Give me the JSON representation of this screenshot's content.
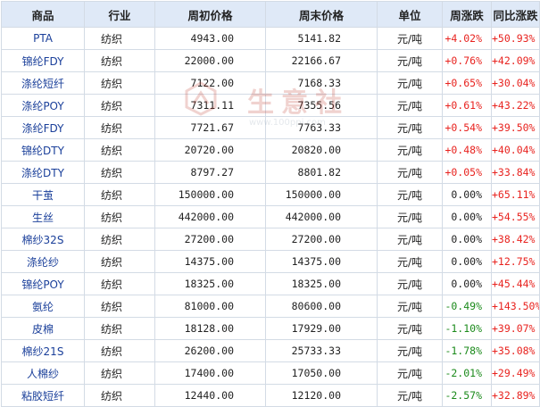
{
  "headers": {
    "name": "商品",
    "industry": "行业",
    "week_open": "周初价格",
    "week_close": "周末价格",
    "unit": "单位",
    "weekly_change": "周涨跌",
    "yoy_change": "同比涨跌"
  },
  "rows": [
    {
      "name": "PTA",
      "industry": "纺织",
      "open": "4943.00",
      "close": "5141.82",
      "unit": "元/吨",
      "week": "+4.02%",
      "yoy": "+50.93%",
      "week_dir": "up"
    },
    {
      "name": "锦纶FDY",
      "industry": "纺织",
      "open": "22000.00",
      "close": "22166.67",
      "unit": "元/吨",
      "week": "+0.76%",
      "yoy": "+42.09%",
      "week_dir": "up"
    },
    {
      "name": "涤纶短纤",
      "industry": "纺织",
      "open": "7122.00",
      "close": "7168.33",
      "unit": "元/吨",
      "week": "+0.65%",
      "yoy": "+30.04%",
      "week_dir": "up"
    },
    {
      "name": "涤纶POY",
      "industry": "纺织",
      "open": "7311.11",
      "close": "7355.56",
      "unit": "元/吨",
      "week": "+0.61%",
      "yoy": "+43.22%",
      "week_dir": "up"
    },
    {
      "name": "涤纶FDY",
      "industry": "纺织",
      "open": "7721.67",
      "close": "7763.33",
      "unit": "元/吨",
      "week": "+0.54%",
      "yoy": "+39.50%",
      "week_dir": "up"
    },
    {
      "name": "锦纶DTY",
      "industry": "纺织",
      "open": "20720.00",
      "close": "20820.00",
      "unit": "元/吨",
      "week": "+0.48%",
      "yoy": "+40.04%",
      "week_dir": "up"
    },
    {
      "name": "涤纶DTY",
      "industry": "纺织",
      "open": "8797.27",
      "close": "8801.82",
      "unit": "元/吨",
      "week": "+0.05%",
      "yoy": "+33.84%",
      "week_dir": "up"
    },
    {
      "name": "干茧",
      "industry": "纺织",
      "open": "150000.00",
      "close": "150000.00",
      "unit": "元/吨",
      "week": "0.00%",
      "yoy": "+65.11%",
      "week_dir": "flat"
    },
    {
      "name": "生丝",
      "industry": "纺织",
      "open": "442000.00",
      "close": "442000.00",
      "unit": "元/吨",
      "week": "0.00%",
      "yoy": "+54.55%",
      "week_dir": "flat"
    },
    {
      "name": "棉纱32S",
      "industry": "纺织",
      "open": "27200.00",
      "close": "27200.00",
      "unit": "元/吨",
      "week": "0.00%",
      "yoy": "+38.42%",
      "week_dir": "flat"
    },
    {
      "name": "涤纶纱",
      "industry": "纺织",
      "open": "14375.00",
      "close": "14375.00",
      "unit": "元/吨",
      "week": "0.00%",
      "yoy": "+12.75%",
      "week_dir": "flat"
    },
    {
      "name": "锦纶POY",
      "industry": "纺织",
      "open": "18325.00",
      "close": "18325.00",
      "unit": "元/吨",
      "week": "0.00%",
      "yoy": "+45.44%",
      "week_dir": "flat"
    },
    {
      "name": "氨纶",
      "industry": "纺织",
      "open": "81000.00",
      "close": "80600.00",
      "unit": "元/吨",
      "week": "-0.49%",
      "yoy": "+143.50%",
      "week_dir": "down"
    },
    {
      "name": "皮棉",
      "industry": "纺织",
      "open": "18128.00",
      "close": "17929.00",
      "unit": "元/吨",
      "week": "-1.10%",
      "yoy": "+39.07%",
      "week_dir": "down"
    },
    {
      "name": "棉纱21S",
      "industry": "纺织",
      "open": "26200.00",
      "close": "25733.33",
      "unit": "元/吨",
      "week": "-1.78%",
      "yoy": "+35.08%",
      "week_dir": "down"
    },
    {
      "name": "人棉纱",
      "industry": "纺织",
      "open": "17400.00",
      "close": "17050.00",
      "unit": "元/吨",
      "week": "-2.01%",
      "yoy": "+29.49%",
      "week_dir": "down"
    },
    {
      "name": "粘胶短纤",
      "industry": "纺织",
      "open": "12440.00",
      "close": "12120.00",
      "unit": "元/吨",
      "week": "-2.57%",
      "yoy": "+32.89%",
      "week_dir": "down"
    }
  ],
  "watermark": {
    "text": "生意社",
    "url": "www.100ppi.com"
  },
  "colors": {
    "header_bg": "#dfe9f7",
    "border": "#d3dbe5",
    "up": "#e8231f",
    "down": "#1b8a1b",
    "name": "#1a3f9a"
  }
}
